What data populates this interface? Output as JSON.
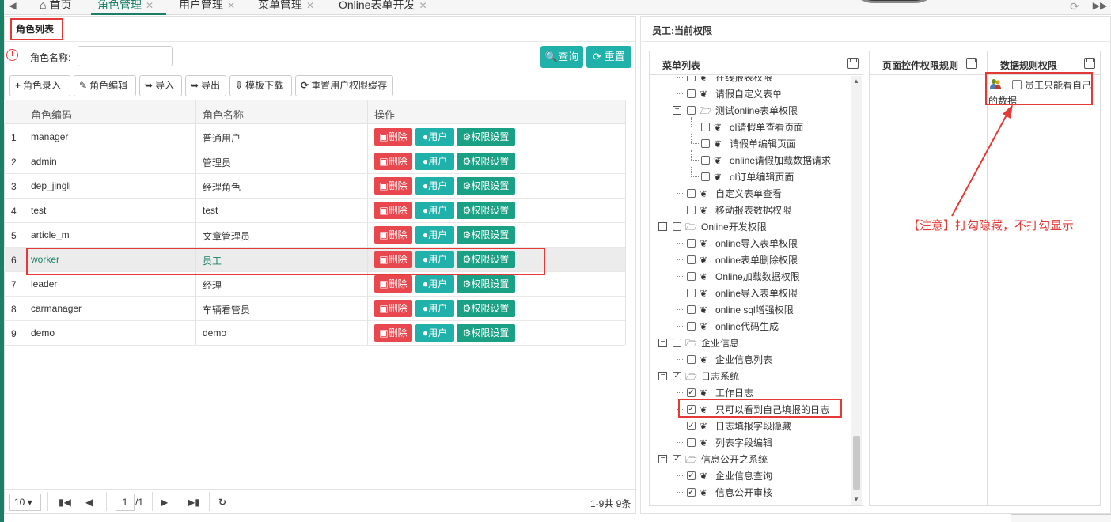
{
  "tabs": [
    {
      "label": "首页",
      "icon": "home-icon",
      "active": false,
      "closable": false
    },
    {
      "label": "角色管理",
      "active": true,
      "closable": true
    },
    {
      "label": "用户管理",
      "active": false,
      "closable": true
    },
    {
      "label": "菜单管理",
      "active": false,
      "closable": true
    },
    {
      "label": "Online表单开发",
      "active": false,
      "closable": true
    }
  ],
  "left": {
    "title": "角色列表",
    "filter_label": "角色名称:",
    "filter_value": "",
    "search_label": "查询",
    "reset_label": "重置",
    "toolbar": [
      "角色录入",
      "角色编辑",
      "导入",
      "导出",
      "模板下载",
      "重置用户权限缓存"
    ],
    "columns": [
      "角色编码",
      "角色名称",
      "操作"
    ],
    "action_labels": {
      "delete": "删除",
      "user": "用户",
      "perm": "权限设置"
    },
    "rows": [
      {
        "n": "1",
        "code": "manager",
        "name": "普通用户"
      },
      {
        "n": "2",
        "code": "admin",
        "name": "管理员"
      },
      {
        "n": "3",
        "code": "dep_jingli",
        "name": "经理角色"
      },
      {
        "n": "4",
        "code": "test",
        "name": "test"
      },
      {
        "n": "5",
        "code": "article_m",
        "name": "文章管理员"
      },
      {
        "n": "6",
        "code": "worker",
        "name": "员工",
        "selected": true
      },
      {
        "n": "7",
        "code": "leader",
        "name": "经理"
      },
      {
        "n": "8",
        "code": "carmanager",
        "name": "车辆看管员"
      },
      {
        "n": "9",
        "code": "demo",
        "name": "demo"
      }
    ],
    "pager": {
      "page_size": "10",
      "page": "1",
      "total_pages": "/1",
      "info": "1-9共 9条"
    }
  },
  "right": {
    "title": "员工:当前权限",
    "menu_title": "菜单列表",
    "control_title": "页面控件权限规则",
    "data_title": "数据规则权限",
    "data_rule_text_1": "员工只能看自己",
    "data_rule_text_2": "的数据",
    "note": "【注意】打勾隐藏，不打勾显示",
    "tree": [
      {
        "label": "在线报表权限",
        "level": 1,
        "type": "leaf",
        "checked": false
      },
      {
        "label": "请假自定义表单",
        "level": 1,
        "type": "leaf",
        "checked": false
      },
      {
        "label": "测试online表单权限",
        "level": 1,
        "type": "folder",
        "checked": false
      },
      {
        "label": "ol请假单查看页面",
        "level": 2,
        "type": "leaf",
        "checked": false
      },
      {
        "label": "请假单编辑页面",
        "level": 2,
        "type": "leaf",
        "checked": false
      },
      {
        "label": "online请假加载数据请求",
        "level": 2,
        "type": "leaf",
        "checked": false
      },
      {
        "label": "ol订单编辑页面",
        "level": 2,
        "type": "leaf",
        "checked": false
      },
      {
        "label": "自定义表单查看",
        "level": 1,
        "type": "leaf",
        "checked": false
      },
      {
        "label": "移动报表数据权限",
        "level": 1,
        "type": "leaf",
        "checked": false
      },
      {
        "label": "Online开发权限",
        "level": 0,
        "type": "folder",
        "checked": false
      },
      {
        "label": "online导入表单权限",
        "level": 1,
        "type": "leaf",
        "checked": false,
        "underline": true
      },
      {
        "label": "online表单删除权限",
        "level": 1,
        "type": "leaf",
        "checked": false
      },
      {
        "label": "Online加载数据权限",
        "level": 1,
        "type": "leaf",
        "checked": false
      },
      {
        "label": "online导入表单权限",
        "level": 1,
        "type": "leaf",
        "checked": false
      },
      {
        "label": "online sql增强权限",
        "level": 1,
        "type": "leaf",
        "checked": false
      },
      {
        "label": "online代码生成",
        "level": 1,
        "type": "leaf",
        "checked": false
      },
      {
        "label": "企业信息",
        "level": 0,
        "type": "folder",
        "checked": false
      },
      {
        "label": "企业信息列表",
        "level": 1,
        "type": "leaf",
        "checked": false
      },
      {
        "label": "日志系统",
        "level": 0,
        "type": "folder",
        "checked": true
      },
      {
        "label": "工作日志",
        "level": 1,
        "type": "leaf",
        "checked": true
      },
      {
        "label": "只可以看到自己填报的日志",
        "level": 1,
        "type": "leaf",
        "checked": true
      },
      {
        "label": "日志填报字段隐藏",
        "level": 1,
        "type": "leaf",
        "checked": true
      },
      {
        "label": "列表字段编辑",
        "level": 1,
        "type": "leaf",
        "checked": false
      },
      {
        "label": "信息公开之系统",
        "level": 0,
        "type": "folder",
        "checked": true
      },
      {
        "label": "企业信息查询",
        "level": 1,
        "type": "leaf",
        "checked": true
      },
      {
        "label": "信息公开审核",
        "level": 1,
        "type": "leaf",
        "checked": true
      }
    ]
  },
  "colors": {
    "accent": "#1a7f66",
    "teal": "#20b2aa",
    "danger": "#e8474e",
    "annotation": "#e53935"
  }
}
